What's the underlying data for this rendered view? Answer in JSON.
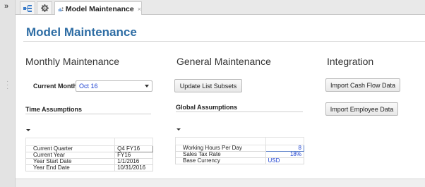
{
  "tabs": {
    "tab1_icon": "hierarchy-icon",
    "tab2_icon": "gear-icon",
    "active_icon": "chart-user-icon",
    "active_label": "Model Maintenance",
    "close_glyph": "×"
  },
  "gutter": {
    "expand_glyph": "»"
  },
  "page": {
    "title": "Model Maintenance"
  },
  "sections": {
    "monthly": "Monthly Maintenance",
    "general": "General Maintenance",
    "integration": "Integration"
  },
  "current_month": {
    "label": "Current Month",
    "value": "Oct 16"
  },
  "buttons": {
    "update_list_subsets": "Update List Subsets",
    "import_cash_flow": "Import Cash Flow Data",
    "import_employee": "Import Employee Data"
  },
  "time_assumptions": {
    "heading": "Time Assumptions",
    "rows": [
      {
        "label": "Current Quarter",
        "value": "Q4 FY16"
      },
      {
        "label": "Current Year",
        "value": "FY16"
      },
      {
        "label": "Year Start Date",
        "value": "1/1/2016"
      },
      {
        "label": "Year End Date",
        "value": "10/31/2016"
      }
    ]
  },
  "global_assumptions": {
    "heading": "Global Assumptions",
    "rows": [
      {
        "label": "Working Hours Per Day",
        "value": "8"
      },
      {
        "label": "Sales Tax Rate",
        "value": "18%"
      },
      {
        "label": "Base Currency",
        "value": "USD"
      }
    ]
  },
  "colors": {
    "title_blue": "#2e6da4",
    "value_blue": "#1a3fd0"
  }
}
